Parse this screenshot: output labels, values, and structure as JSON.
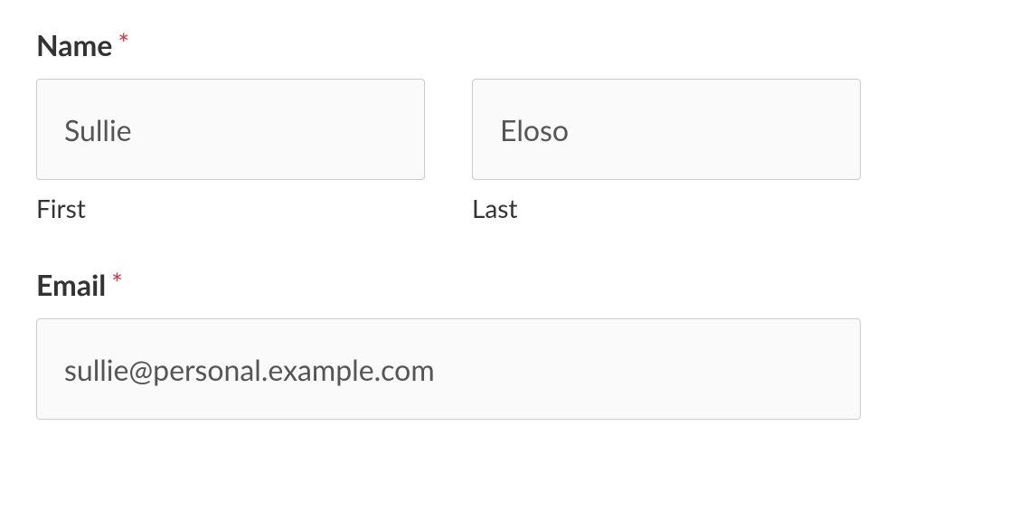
{
  "form": {
    "name": {
      "label": "Name",
      "required_marker": "*",
      "first": {
        "value": "Sullie",
        "sublabel": "First"
      },
      "last": {
        "value": "Eloso",
        "sublabel": "Last"
      }
    },
    "email": {
      "label": "Email",
      "required_marker": "*",
      "value": "sullie@personal.example.com"
    }
  }
}
